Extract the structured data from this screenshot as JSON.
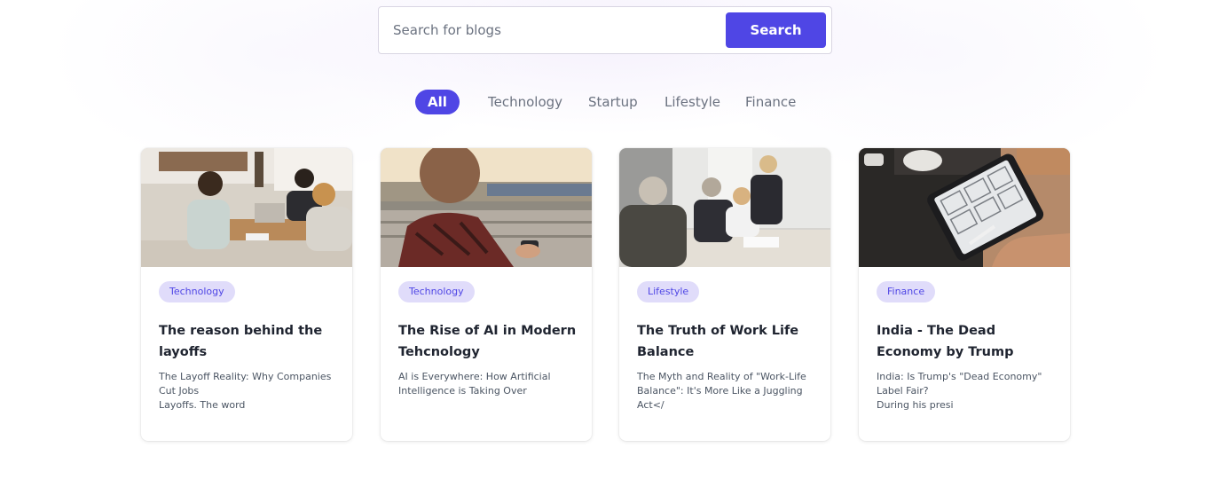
{
  "search": {
    "placeholder": "Search for blogs",
    "button_label": "Search"
  },
  "tabs": [
    {
      "label": "All",
      "active": true
    },
    {
      "label": "Technology",
      "active": false
    },
    {
      "label": "Startup",
      "active": false
    },
    {
      "label": "Lifestyle",
      "active": false
    },
    {
      "label": "Finance",
      "active": false
    }
  ],
  "posts": [
    {
      "category": "Technology",
      "title": "The reason behind the layoffs",
      "excerpt": "The Layoff Reality: Why Companies Cut Jobs\nLayoffs. The word"
    },
    {
      "category": "Technology",
      "title": "The Rise of AI in Modern Tehcnology",
      "excerpt": "AI is Everywhere: How Artificial Intelligence is Taking Over"
    },
    {
      "category": "Lifestyle",
      "title": "The Truth of Work Life Balance",
      "excerpt": "The Myth and Reality of \"Work-Life Balance\": It's More Like a Juggling Act</"
    },
    {
      "category": "Finance",
      "title": "India - The Dead Economy by Trump",
      "excerpt": "India: Is Trump's \"Dead Economy\" Label Fair?\nDuring his presi"
    }
  ],
  "colors": {
    "accent": "#4f46e5",
    "badge_bg": "#e0dcfa",
    "text_muted": "#6b7280"
  }
}
